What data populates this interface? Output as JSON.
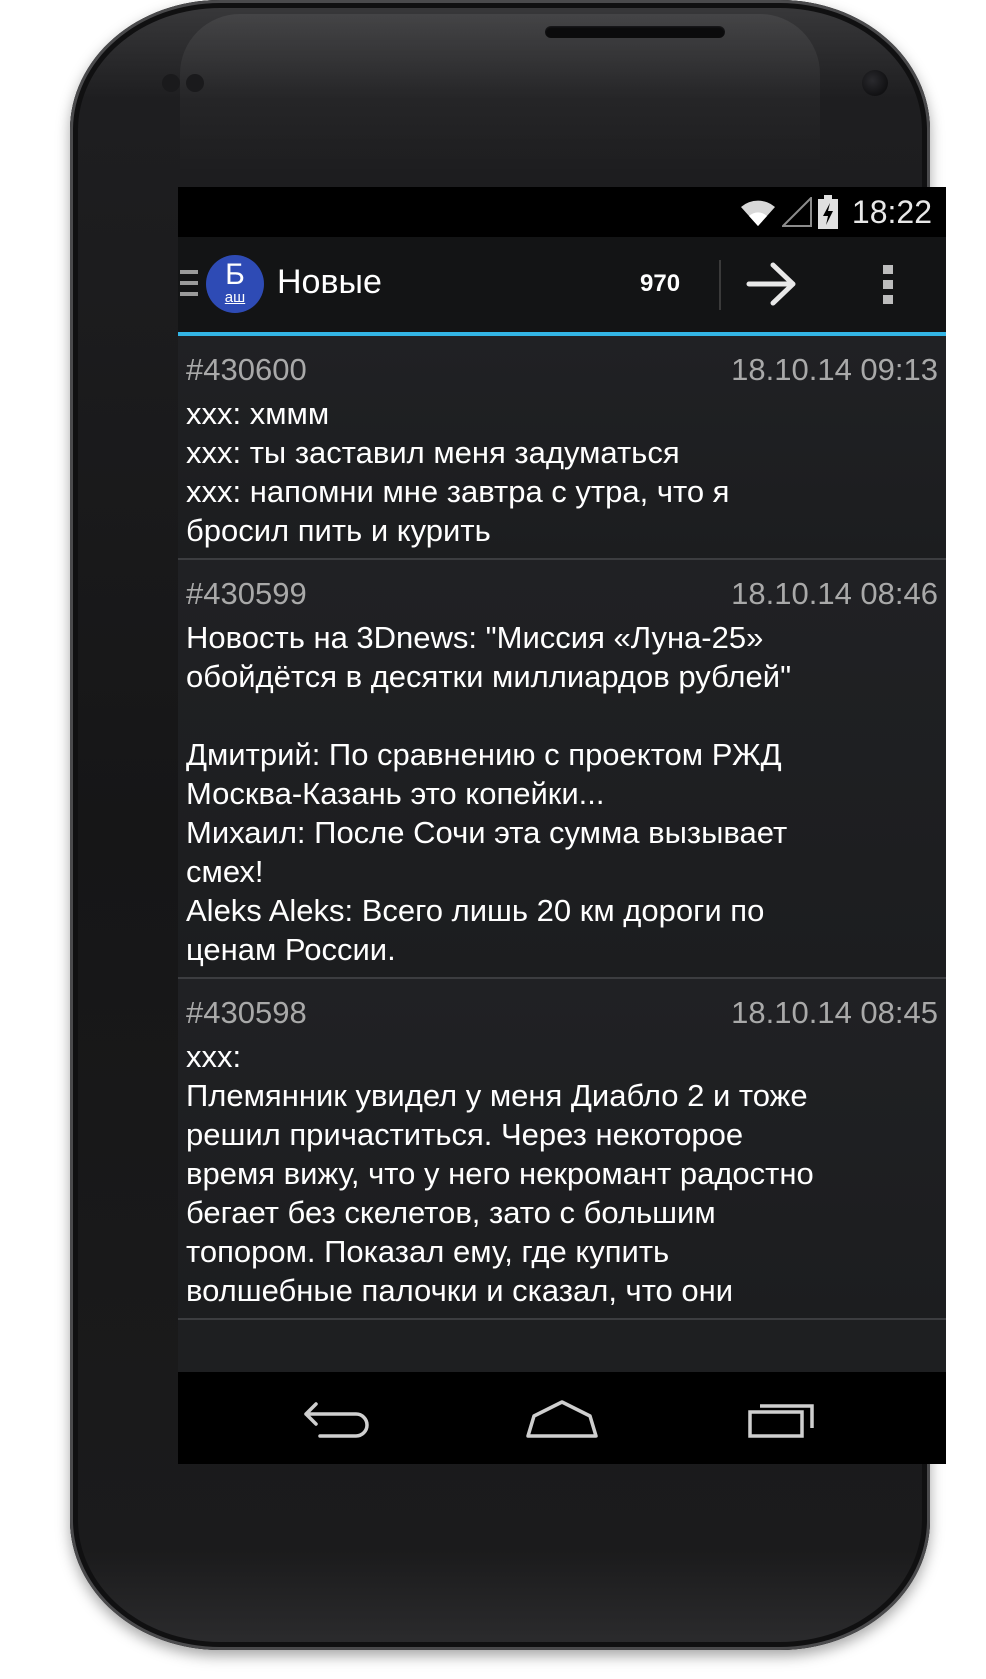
{
  "status_bar": {
    "time": "18:22",
    "icons": [
      "wifi-icon",
      "signal-icon",
      "battery-charging-icon"
    ]
  },
  "action_bar": {
    "logo_main": "Б",
    "logo_sub": "аш",
    "title": "Новые",
    "counter": "970",
    "next_icon": "arrow-right-icon",
    "menu_icon": "overflow-menu-icon"
  },
  "quotes": [
    {
      "id": "#430600",
      "date": "18.10.14 09:13",
      "text": "xxx: хммм\nxxx: ты заставил меня задуматься\nxxx: напомни мне завтра с утра, что я\nбросил пить и курить"
    },
    {
      "id": "#430599",
      "date": "18.10.14 08:46",
      "text": "Новость на 3Dnews: \"Миссия «Луна-25»\nобойдётся в десятки миллиардов рублей\"\n\nДмитрий: По сравнению с проектом РЖД\nМосква-Казань это копейки...\nМихаил: После Сочи эта сумма вызывает\nсмех!\nAleks Aleks: Всего лишь 20 км дороги по\nценам России."
    },
    {
      "id": "#430598",
      "date": "18.10.14 08:45",
      "text": "xxx:\nПлемянник увидел у меня Диабло 2 и тоже\nрешил причаститься. Через некоторое\nвремя вижу, что у него некромант радостно\nбегает без скелетов, зато с большим\nтопором. Показал ему, где купить\nволшебные палочки и сказал, что они"
    }
  ],
  "nav_bar": {
    "back_icon": "back-icon",
    "home_icon": "home-icon",
    "recents_icon": "recent-apps-icon"
  },
  "colors": {
    "accent": "#33b5e5",
    "logo": "#2e4bb5",
    "background": "#1e1f21"
  }
}
